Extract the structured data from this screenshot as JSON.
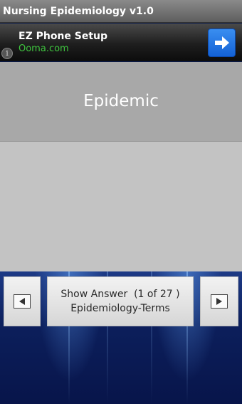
{
  "app": {
    "title": "Nursing Epidemiology v1.0"
  },
  "ad": {
    "title": "EZ Phone Setup",
    "url": "Ooma.com",
    "info_icon": "info-icon",
    "info_glyph": "i",
    "action_icon": "arrow-right-icon",
    "accent_color": "#1e74e6",
    "url_color": "#3ec43e"
  },
  "card": {
    "question": "Epidemic",
    "answer": ""
  },
  "controls": {
    "show_answer_label": "Show Answer  (1 of 27 )",
    "category": "Epidemiology-Terms",
    "current": 1,
    "total": 27,
    "prev_icon": "triangle-left-icon",
    "next_icon": "triangle-right-icon"
  }
}
